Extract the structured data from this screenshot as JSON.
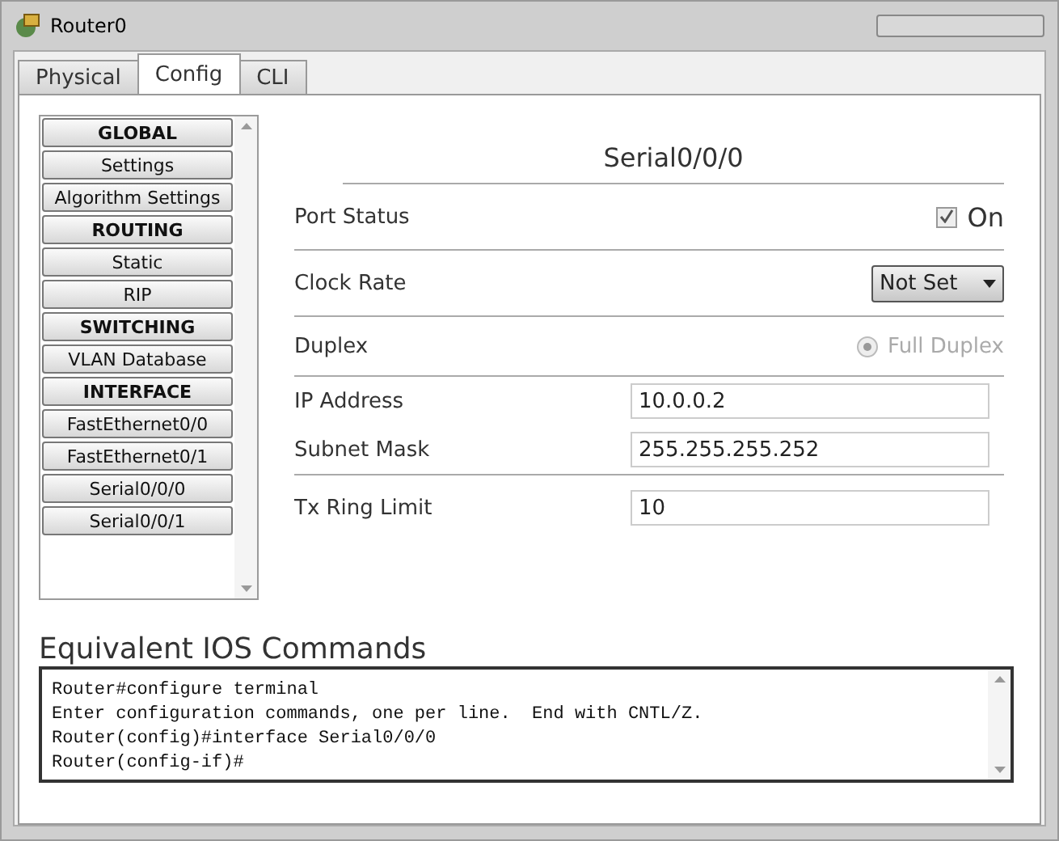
{
  "window": {
    "title": "Router0"
  },
  "tabs": [
    {
      "label": "Physical",
      "selected": false
    },
    {
      "label": "Config",
      "selected": true
    },
    {
      "label": "CLI",
      "selected": false
    }
  ],
  "sidebar": {
    "items": [
      {
        "label": "GLOBAL",
        "kind": "header"
      },
      {
        "label": "Settings",
        "kind": "item"
      },
      {
        "label": "Algorithm Settings",
        "kind": "item"
      },
      {
        "label": "ROUTING",
        "kind": "header"
      },
      {
        "label": "Static",
        "kind": "item"
      },
      {
        "label": "RIP",
        "kind": "item"
      },
      {
        "label": "SWITCHING",
        "kind": "header"
      },
      {
        "label": "VLAN Database",
        "kind": "item"
      },
      {
        "label": "INTERFACE",
        "kind": "header"
      },
      {
        "label": "FastEthernet0/0",
        "kind": "item"
      },
      {
        "label": "FastEthernet0/1",
        "kind": "item"
      },
      {
        "label": "Serial0/0/0",
        "kind": "item"
      },
      {
        "label": "Serial0/0/1",
        "kind": "item"
      }
    ]
  },
  "panel": {
    "title": "Serial0/0/0",
    "port_status": {
      "label": "Port Status",
      "checked": true,
      "text": "On"
    },
    "clock_rate": {
      "label": "Clock Rate",
      "value": "Not Set"
    },
    "duplex": {
      "label": "Duplex",
      "option": "Full Duplex",
      "selected": true,
      "disabled": true
    },
    "ip_address": {
      "label": "IP Address",
      "value": "10.0.0.2"
    },
    "subnet_mask": {
      "label": "Subnet Mask",
      "value": "255.255.255.252"
    },
    "tx_ring_limit": {
      "label": "Tx Ring Limit",
      "value": "10"
    }
  },
  "console": {
    "title": "Equivalent IOS Commands",
    "lines": [
      "Router#configure terminal",
      "Enter configuration commands, one per line.  End with CNTL/Z.",
      "Router(config)#interface Serial0/0/0",
      "Router(config-if)#"
    ]
  }
}
